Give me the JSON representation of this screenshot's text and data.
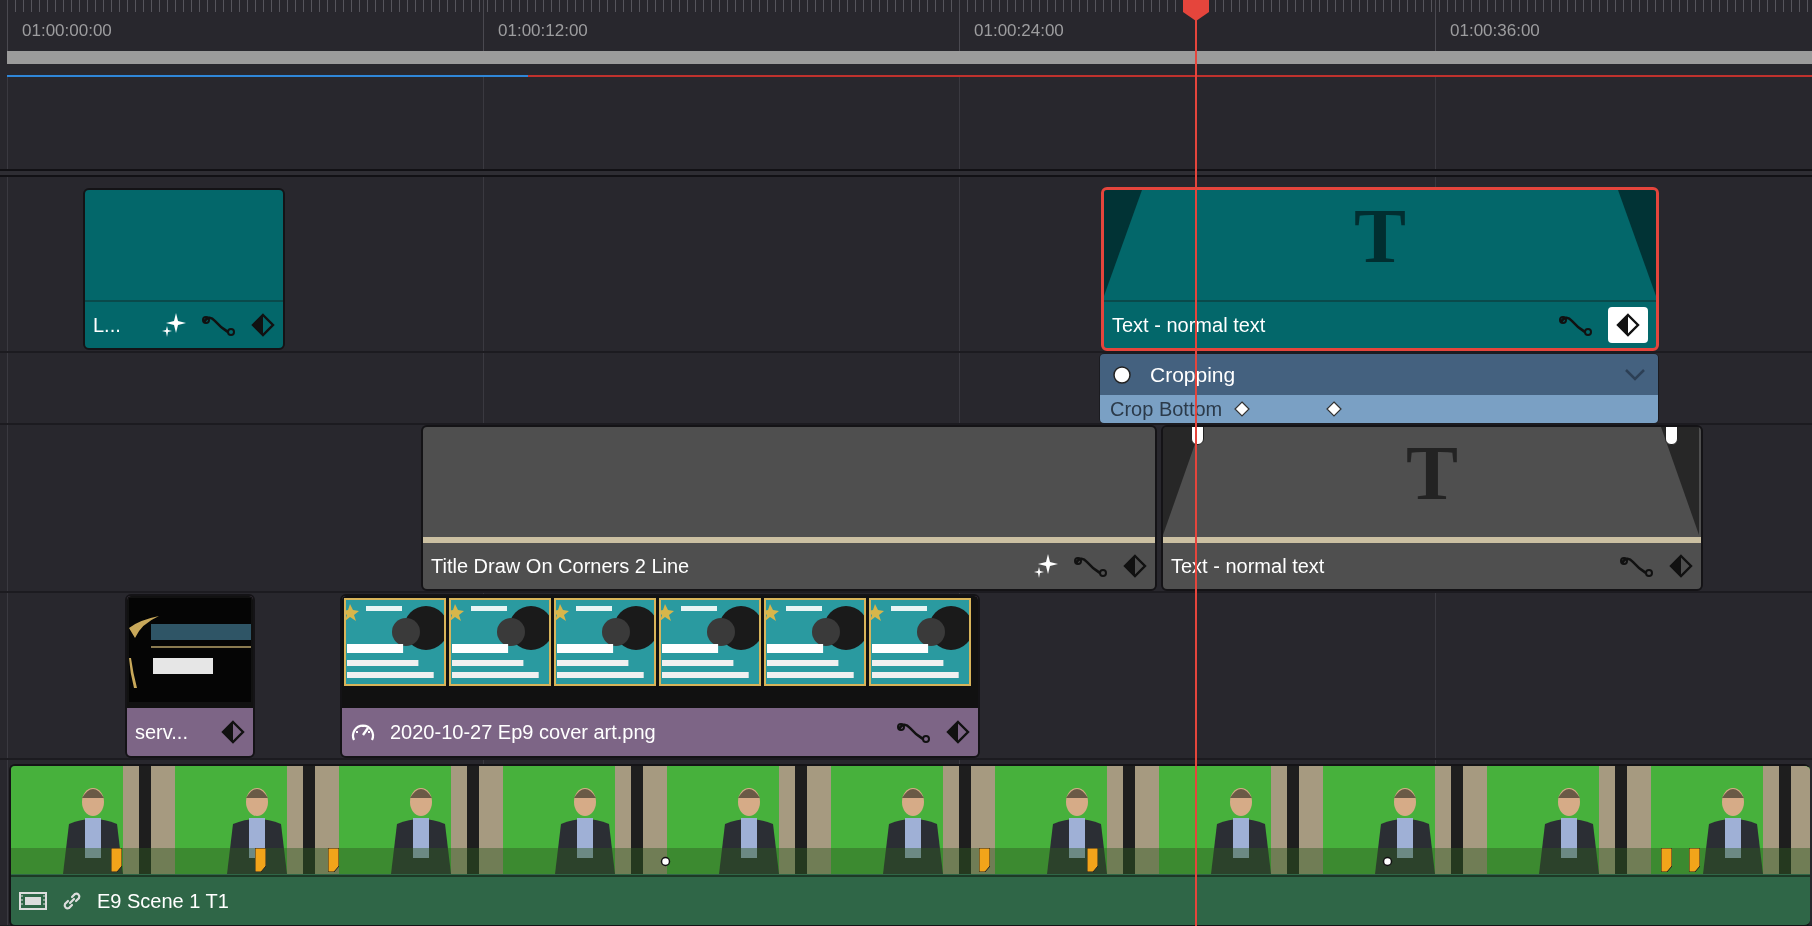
{
  "ruler": {
    "timecodes": [
      "01:00:00:00",
      "01:00:12:00",
      "01:00:24:00",
      "01:00:36:00"
    ]
  },
  "tracks": [
    {
      "clips": [
        {
          "kind": "title",
          "label": "L...",
          "color": "#03676a",
          "selected": false
        },
        {
          "kind": "text",
          "label": "Text - normal text",
          "glyph": "T",
          "color": "#03676a",
          "selected": true
        }
      ]
    },
    {
      "keyframe_panel": {
        "title": "Cropping",
        "parameter": "Crop Bottom"
      }
    },
    {
      "clips": [
        {
          "kind": "title",
          "label": "Title Draw On Corners 2 Line",
          "color": "#4f4f4f",
          "selected": false
        },
        {
          "kind": "text",
          "label": "Text - normal text",
          "glyph": "T",
          "color": "#4f4f4f",
          "selected": false
        }
      ]
    },
    {
      "clips": [
        {
          "label": "serv...",
          "color": "#7d6586",
          "selected": false
        },
        {
          "label": "2020-10-27 Ep9 cover art.png",
          "color": "#7d6586",
          "selected": false
        }
      ]
    },
    {
      "clips": [
        {
          "kind": "video",
          "label": "E9 Scene 1 T1",
          "color": "#2f6647",
          "selected": false
        }
      ]
    }
  ]
}
